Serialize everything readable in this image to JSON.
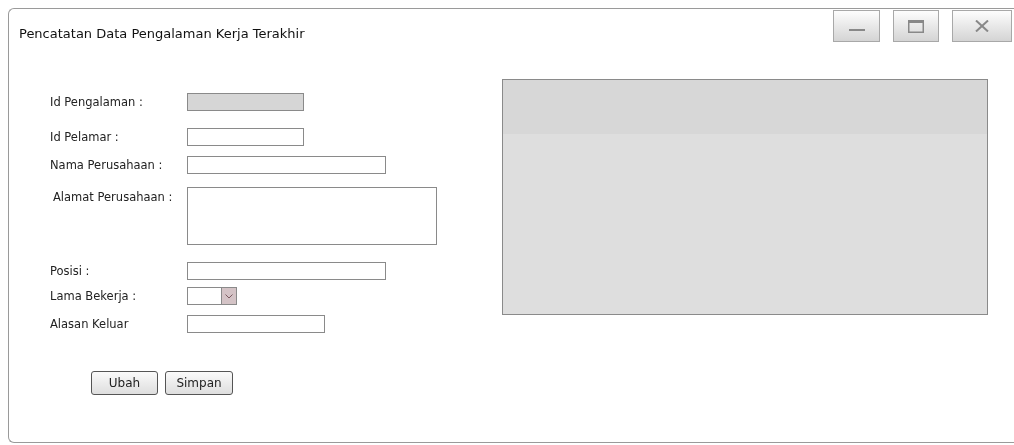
{
  "window": {
    "title": "Pencatatan Data Pengalaman Kerja Terakhir",
    "controls": [
      {
        "kind": "minimize"
      },
      {
        "kind": "maximize"
      },
      {
        "kind": "close"
      }
    ]
  },
  "form": {
    "fields": [
      {
        "label": "Id Pengalaman :",
        "kind": "text",
        "disabled": true
      },
      {
        "label": "Id Pelamar :",
        "kind": "text",
        "disabled": false
      },
      {
        "label": "Nama Perusahaan :",
        "kind": "text",
        "disabled": false
      },
      {
        "label": "Alamat Perusahaan :",
        "kind": "textarea",
        "disabled": false
      },
      {
        "label": "Posisi :",
        "kind": "text",
        "disabled": false
      },
      {
        "label": "Lama Bekerja :",
        "kind": "select",
        "disabled": false
      },
      {
        "label": "Alasan Keluar",
        "kind": "text",
        "disabled": false
      }
    ],
    "buttons": [
      "Ubah",
      "Simpan"
    ]
  },
  "grid": {
    "kind": "table"
  }
}
